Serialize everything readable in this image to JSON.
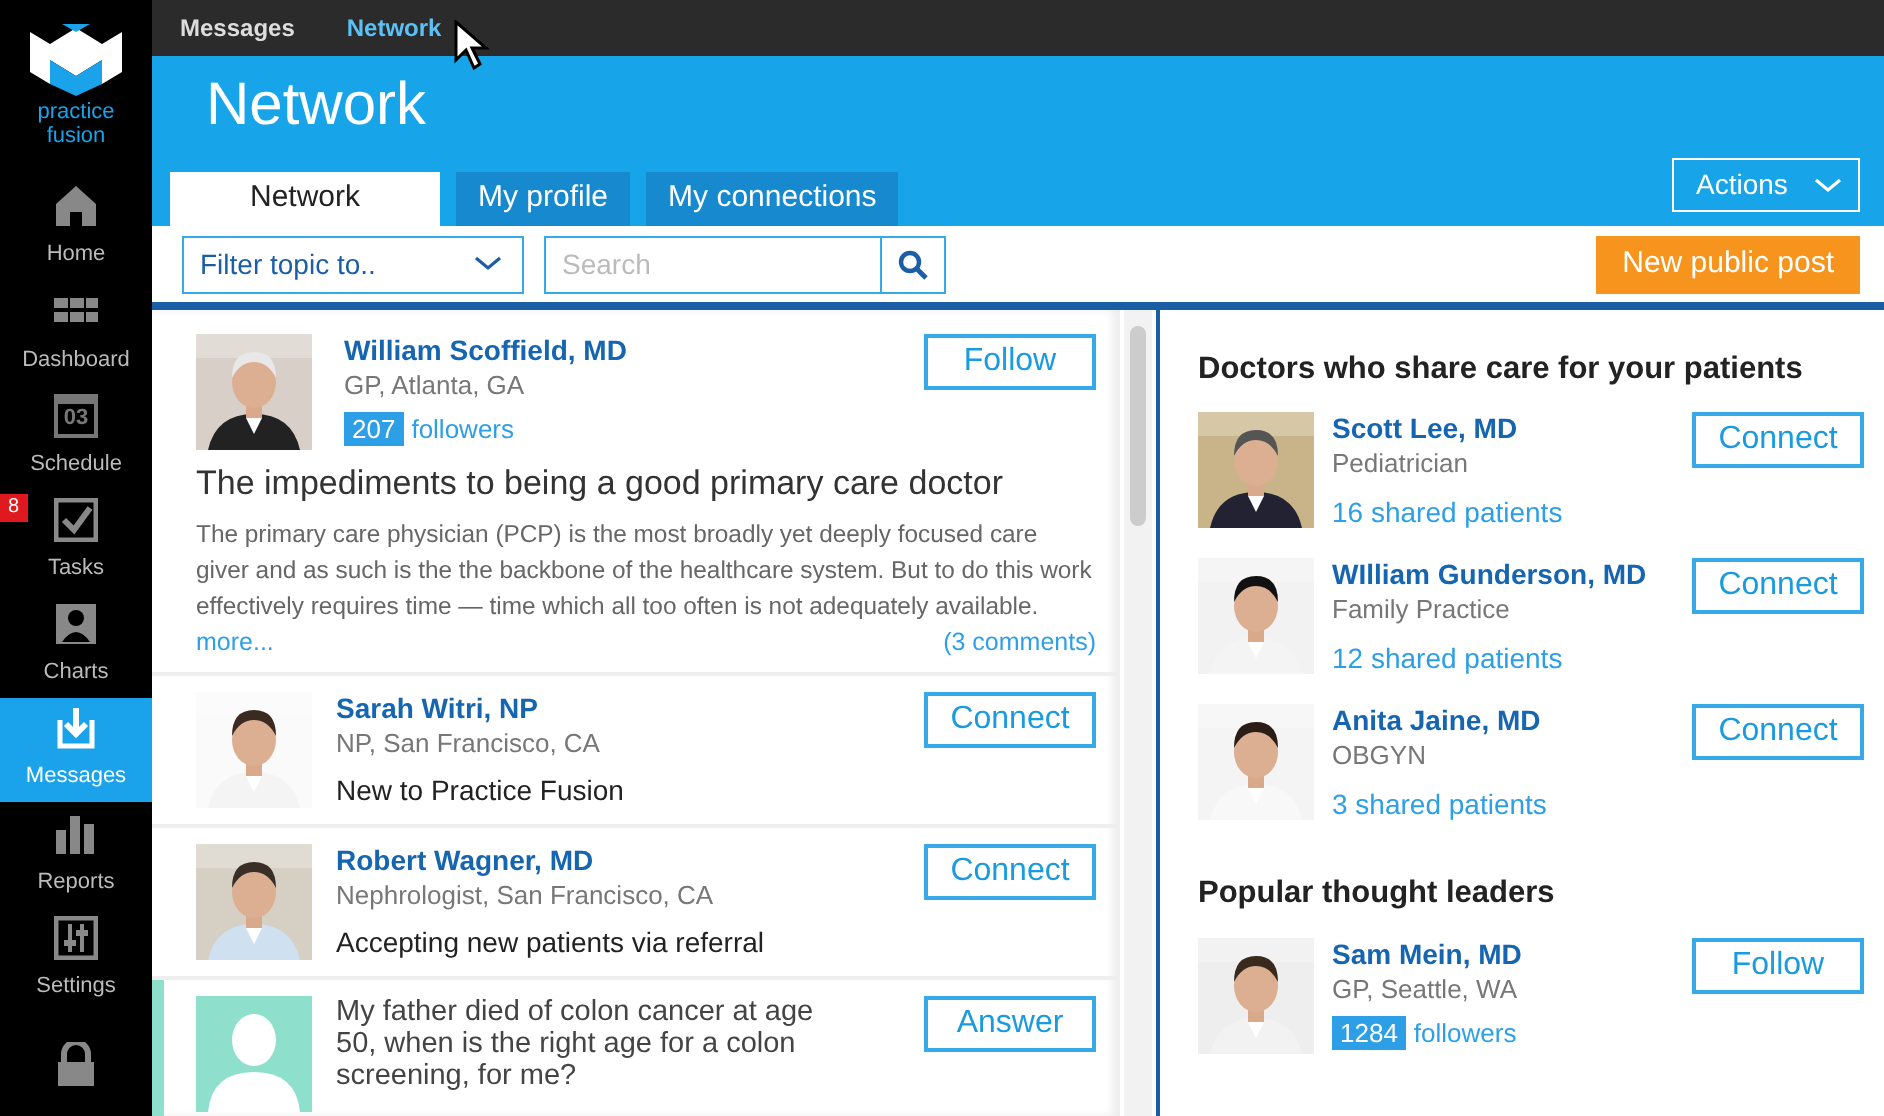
{
  "top_nav": [
    {
      "label": "Messages",
      "selected": false
    },
    {
      "label": "Network",
      "selected": true
    }
  ],
  "sidebar": {
    "brand_lines": [
      "practice",
      "fusion"
    ],
    "items": [
      {
        "kind": "home",
        "label": "Home",
        "selected": false
      },
      {
        "kind": "dashboard",
        "label": "Dashboard",
        "selected": false
      },
      {
        "kind": "schedule",
        "label": "Schedule",
        "icon_text": "03",
        "selected": false
      },
      {
        "kind": "tasks",
        "label": "Tasks",
        "badge": "8",
        "selected": false
      },
      {
        "kind": "charts",
        "label": "Charts",
        "selected": false
      },
      {
        "kind": "messages",
        "label": "Messages",
        "selected": true
      },
      {
        "kind": "reports",
        "label": "Reports",
        "selected": false
      },
      {
        "kind": "settings",
        "label": "Settings",
        "selected": false
      },
      {
        "kind": "lock",
        "selected": false
      }
    ]
  },
  "page_title": "Network",
  "tabs": [
    {
      "label": "Network",
      "selected": true
    },
    {
      "label": "My profile",
      "selected": false
    },
    {
      "label": "My connections",
      "selected": false
    }
  ],
  "actions_button": "Actions",
  "filter": {
    "value": "Filter topic to.."
  },
  "search": {
    "placeholder": "Search"
  },
  "new_post_button": "New public post",
  "feed": [
    {
      "kind": "post",
      "name": "William Scoffield, MD",
      "subtitle": "GP, Atlanta, GA",
      "followers_count": "207",
      "followers_label": "followers",
      "action": "Follow",
      "title": "The impediments to being a good primary care doctor",
      "body": "The primary care physician (PCP) is the most broadly yet deeply focused care giver and as such is the the backbone of the healthcare system. But to do this work effectively requires time — time which all too often is not adequately available.",
      "more": "more...",
      "comments": "(3 comments)"
    },
    {
      "kind": "person",
      "name": "Sarah Witri, NP",
      "subtitle": "NP, San Francisco, CA",
      "note": "New to Practice Fusion",
      "action": "Connect"
    },
    {
      "kind": "person",
      "name": "Robert Wagner, MD",
      "subtitle": "Nephrologist, San Francisco, CA",
      "note": "Accepting new patients via referral",
      "action": "Connect"
    },
    {
      "kind": "question",
      "question": "My father died of colon cancer at age 50, when is the right age for a colon screening, for me?",
      "action": "Answer"
    }
  ],
  "side_sections": [
    {
      "title": "Doctors who share care for your patients",
      "people": [
        {
          "name": "Scott Lee, MD",
          "subtitle": "Pediatrician",
          "shared": "16 shared patients",
          "action": "Connect"
        },
        {
          "name": "WIlliam Gunderson, MD",
          "subtitle": "Family Practice",
          "shared": "12 shared patients",
          "action": "Connect"
        },
        {
          "name": "Anita Jaine, MD",
          "subtitle": "OBGYN",
          "shared": "3 shared patients",
          "action": "Connect"
        }
      ]
    },
    {
      "title": "Popular thought leaders",
      "people": [
        {
          "name": "Sam Mein, MD",
          "subtitle": "GP, Seattle, WA",
          "followers_count": "1284",
          "followers_label": "followers",
          "action": "Follow"
        }
      ]
    }
  ]
}
